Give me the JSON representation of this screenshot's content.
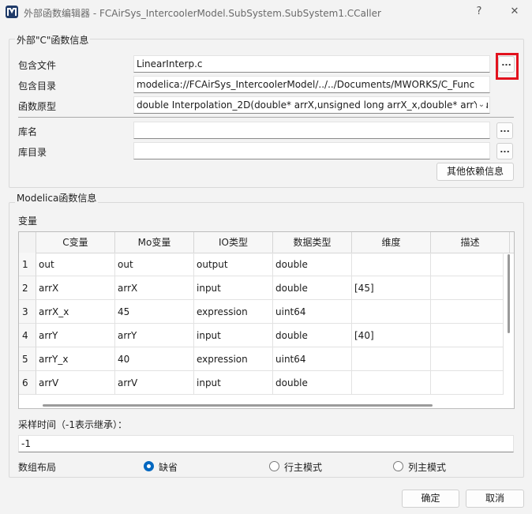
{
  "window": {
    "title": "外部函数编辑器 - FCAirSys_IntercoolerModel.SubSystem.SubSystem1.CCaller",
    "help_glyph": "?",
    "close_glyph": "✕",
    "icon": "app-logo-icon"
  },
  "c_info": {
    "group_title": "外部\"C\"函数信息",
    "include_file_label": "包含文件",
    "include_file_value": "LinearInterp.c",
    "include_dir_label": "包含目录",
    "include_dir_value": "modelica://FCAirSys_IntercoolerModel/../../Documents/MWORKS/C_Func",
    "prototype_label": "函数原型",
    "prototype_value": "double Interpolation_2D(double* arrX,unsigned long arrX_x,double* arrY,u",
    "lib_name_label": "库名",
    "lib_name_value": "",
    "lib_dir_label": "库目录",
    "lib_dir_value": "",
    "browse_label": "...",
    "other_deps_label": "其他依赖信息",
    "highlight_color": "#e2121e"
  },
  "modelica_info": {
    "group_title": "Modelica函数信息",
    "vars_label": "变量",
    "columns": [
      "C变量",
      "Mo变量",
      "IO类型",
      "数据类型",
      "维度",
      "描述"
    ],
    "rows": [
      {
        "n": "1",
        "c": "out",
        "mo": "out",
        "io": "output",
        "dtype": "double",
        "dim": "",
        "desc": ""
      },
      {
        "n": "2",
        "c": "arrX",
        "mo": "arrX",
        "io": "input",
        "dtype": "double",
        "dim": "[45]",
        "desc": ""
      },
      {
        "n": "3",
        "c": "arrX_x",
        "mo": "45",
        "io": "expression",
        "dtype": "uint64",
        "dim": "",
        "desc": ""
      },
      {
        "n": "4",
        "c": "arrY",
        "mo": "arrY",
        "io": "input",
        "dtype": "double",
        "dim": "[40]",
        "desc": ""
      },
      {
        "n": "5",
        "c": "arrY_x",
        "mo": "40",
        "io": "expression",
        "dtype": "uint64",
        "dim": "",
        "desc": ""
      },
      {
        "n": "6",
        "c": "arrV",
        "mo": "arrV",
        "io": "input",
        "dtype": "double",
        "dim": "",
        "desc": ""
      }
    ],
    "sample_time_label": "采样时间（-1表示继承）：",
    "sample_time_value": "-1",
    "layout_label": "数组布局",
    "layout_options": [
      "缺省",
      "行主模式",
      "列主模式"
    ],
    "layout_selected": "缺省"
  },
  "footer": {
    "ok_label": "确定",
    "cancel_label": "取消"
  }
}
